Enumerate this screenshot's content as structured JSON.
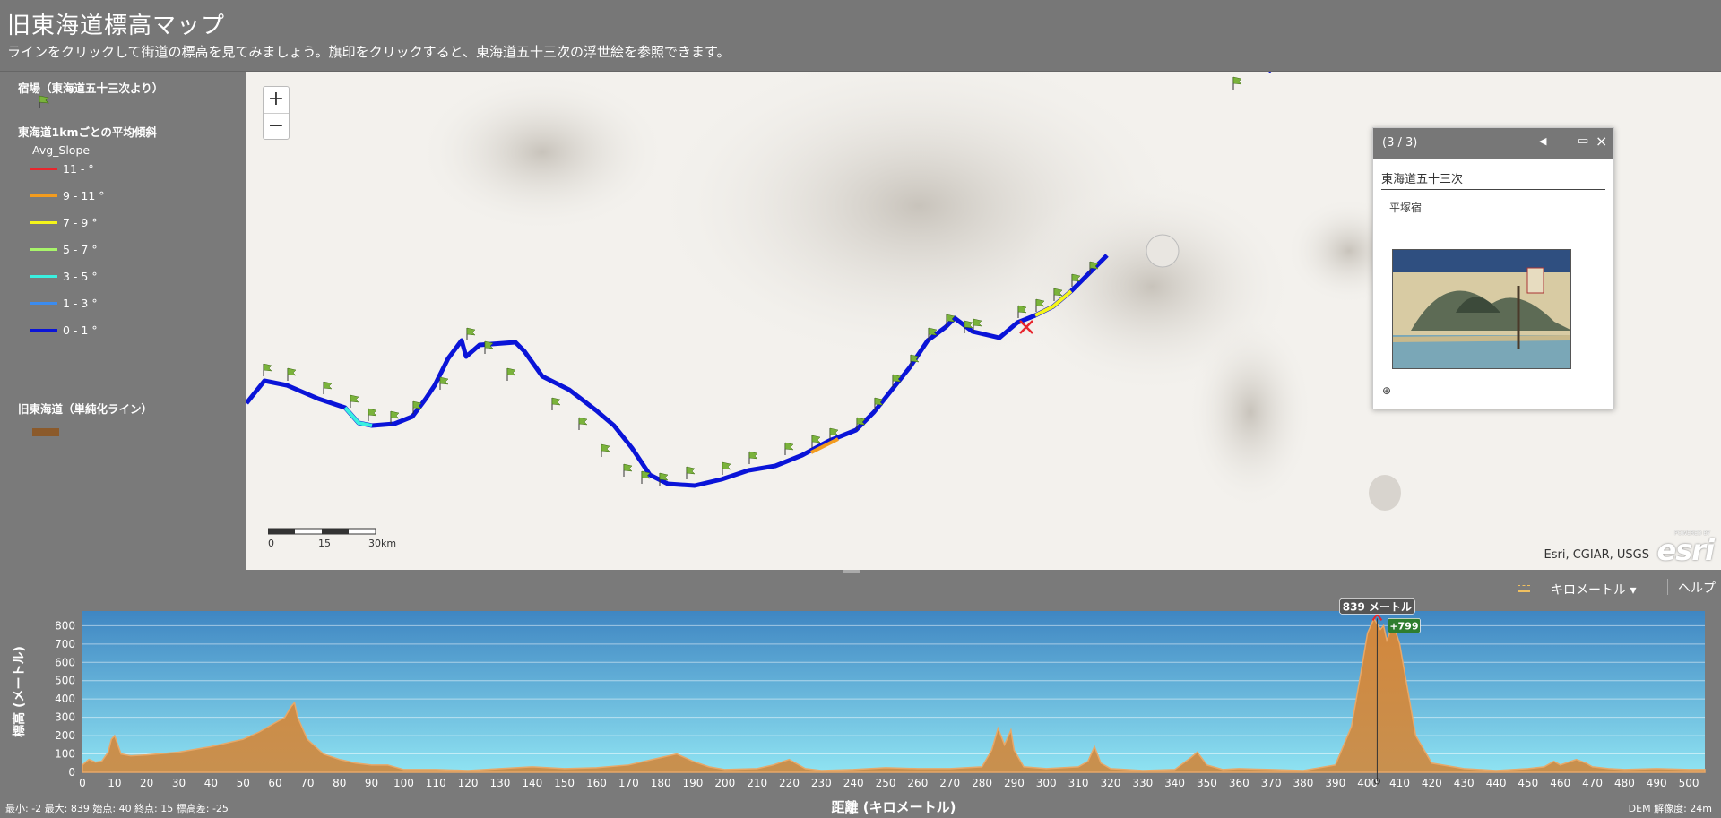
{
  "header": {
    "title": "旧東海道標高マップ",
    "subtitle": "ラインをクリックして街道の標高を見てみましょう。旗印をクリックすると、東海道五十三次の浮世絵を参照できます。"
  },
  "legend": {
    "stations_title": "宿場（東海道五十三次より）",
    "slope_title": "東海道1kmごとの平均傾斜",
    "slope_field": "Avg_Slope",
    "slope_classes": [
      {
        "label": "11 - °",
        "color": "#e8262d"
      },
      {
        "label": "9 - 11 °",
        "color": "#f39c1f"
      },
      {
        "label": "7 - 9 °",
        "color": "#f5f51a"
      },
      {
        "label": "5 - 7 °",
        "color": "#a8f56a"
      },
      {
        "label": "3 - 5 °",
        "color": "#3af0e0"
      },
      {
        "label": "1 - 3 °",
        "color": "#3b8cf0"
      },
      {
        "label": "0 - 1 °",
        "color": "#0a14d8"
      }
    ],
    "route_title": "旧東海道（単純化ライン）",
    "route_color": "#8b5a2b"
  },
  "map": {
    "zoom_in": "+",
    "zoom_out": "−",
    "scale_labels": [
      "0",
      "15",
      "30km"
    ],
    "attribution": "Esri, CGIAR, USGS",
    "logo": "esri",
    "logo_powered": "POWERED BY"
  },
  "popup": {
    "count": "(3 / 3)",
    "layer": "東海道五十三次",
    "station": "平塚宿",
    "icons": {
      "prev": "triangle-left-icon",
      "maximize": "maximize-icon",
      "close": "close-icon",
      "zoom": "zoom-to-icon"
    }
  },
  "profile": {
    "units_label": "キロメートル ▾",
    "help_label": "ヘルプ",
    "y_axis_label": "標高 (メートル)",
    "x_axis_label": "距離 (キロメートル)",
    "stats": "最小: -2 最大: 839 始点: 40 終点: 15 標高差: -25",
    "dem": "DEM 解像度: 24m",
    "marker_label": "839 メートル",
    "marker_delta": "+799"
  },
  "chart_data": {
    "type": "area",
    "title": "",
    "xlabel": "距離 (キロメートル)",
    "ylabel": "標高 (メートル)",
    "xlim": [
      0,
      505
    ],
    "ylim": [
      0,
      880
    ],
    "x_ticks": [
      0,
      10,
      20,
      30,
      40,
      50,
      60,
      70,
      80,
      90,
      100,
      110,
      120,
      130,
      140,
      150,
      160,
      170,
      180,
      190,
      200,
      210,
      220,
      230,
      240,
      250,
      260,
      270,
      280,
      290,
      300,
      310,
      320,
      330,
      340,
      350,
      360,
      370,
      380,
      390,
      400,
      410,
      420,
      430,
      440,
      450,
      460,
      470,
      480,
      490,
      500
    ],
    "y_ticks": [
      0,
      100,
      200,
      300,
      400,
      500,
      600,
      700,
      800
    ],
    "grid": true,
    "series": [
      {
        "x": [
          0,
          2,
          4,
          6,
          8,
          9,
          10,
          12,
          15,
          20,
          30,
          40,
          50,
          55,
          60,
          63,
          65,
          66,
          67,
          70,
          75,
          80,
          85,
          90,
          95,
          100,
          110,
          120,
          130,
          140,
          150,
          160,
          170,
          180,
          185,
          190,
          195,
          200,
          210,
          215,
          220,
          225,
          230,
          240,
          250,
          260,
          270,
          280,
          283,
          285,
          287,
          289,
          290,
          293,
          300,
          310,
          313,
          315,
          317,
          320,
          330,
          340,
          345,
          347,
          350,
          355,
          360,
          370,
          380,
          390,
          395,
          398,
          400,
          402,
          404,
          405,
          406,
          408,
          410,
          413,
          415,
          420,
          430,
          440,
          450,
          455,
          458,
          460,
          465,
          468,
          470,
          475,
          480,
          490,
          500,
          505
        ],
        "y": [
          40,
          70,
          55,
          60,
          110,
          180,
          200,
          100,
          90,
          95,
          110,
          140,
          180,
          220,
          270,
          300,
          360,
          380,
          300,
          180,
          100,
          70,
          50,
          40,
          40,
          15,
          15,
          10,
          20,
          30,
          20,
          25,
          40,
          80,
          100,
          60,
          30,
          15,
          20,
          40,
          70,
          20,
          10,
          15,
          25,
          20,
          20,
          30,
          120,
          240,
          150,
          230,
          120,
          30,
          20,
          30,
          60,
          140,
          50,
          20,
          10,
          15,
          80,
          110,
          40,
          15,
          20,
          15,
          10,
          40,
          250,
          550,
          760,
          839,
          780,
          800,
          720,
          810,
          700,
          400,
          200,
          50,
          20,
          10,
          20,
          30,
          60,
          40,
          70,
          50,
          30,
          20,
          15,
          20,
          15,
          15
        ]
      }
    ],
    "marker": {
      "x": 403,
      "y": 839
    }
  }
}
